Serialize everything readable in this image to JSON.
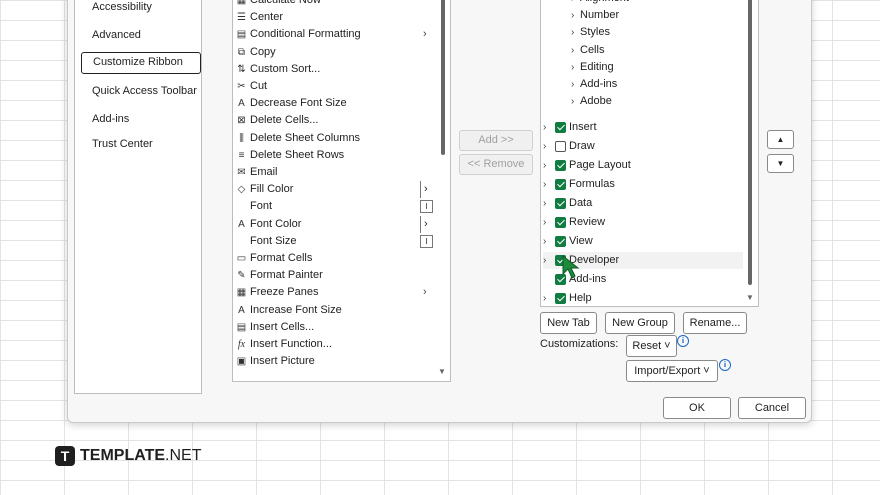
{
  "nav": {
    "items": [
      "Accessibility",
      "Advanced",
      "Customize Ribbon",
      "Quick Access Toolbar",
      "Add-ins",
      "Trust Center"
    ],
    "selected": "Customize Ribbon"
  },
  "commands": [
    {
      "label": "Calculate Now",
      "icon": "calculator-icon",
      "glyph": "▦"
    },
    {
      "label": "Center",
      "icon": "align-center-icon",
      "glyph": "☰"
    },
    {
      "label": "Conditional Formatting",
      "icon": "conditional-formatting-icon",
      "glyph": "▤",
      "arrow": "›"
    },
    {
      "label": "Copy",
      "icon": "copy-icon",
      "glyph": "⧉"
    },
    {
      "label": "Custom Sort...",
      "icon": "sort-icon",
      "glyph": "⇅"
    },
    {
      "label": "Cut",
      "icon": "scissors-icon",
      "glyph": "✂"
    },
    {
      "label": "Decrease Font Size",
      "icon": "decrease-font-icon",
      "glyph": "A"
    },
    {
      "label": "Delete Cells...",
      "icon": "delete-cells-icon",
      "glyph": "⊠"
    },
    {
      "label": "Delete Sheet Columns",
      "icon": "delete-columns-icon",
      "glyph": "⫼"
    },
    {
      "label": "Delete Sheet Rows",
      "icon": "delete-rows-icon",
      "glyph": "≡"
    },
    {
      "label": "Email",
      "icon": "email-icon",
      "glyph": "✉"
    },
    {
      "label": "Fill Color",
      "icon": "fill-color-icon",
      "glyph": "◇",
      "bar_arrow": "›"
    },
    {
      "label": "Font",
      "icon": "",
      "glyph": "",
      "mini": "I"
    },
    {
      "label": "Font Color",
      "icon": "font-color-icon",
      "glyph": "A",
      "bar_arrow": "›"
    },
    {
      "label": "Font Size",
      "icon": "",
      "glyph": "",
      "mini": "I"
    },
    {
      "label": "Format Cells",
      "icon": "format-cells-icon",
      "glyph": "▭"
    },
    {
      "label": "Format Painter",
      "icon": "paintbrush-icon",
      "glyph": "✎"
    },
    {
      "label": "Freeze Panes",
      "icon": "freeze-panes-icon",
      "glyph": "▦",
      "arrow": "›"
    },
    {
      "label": "Increase Font Size",
      "icon": "increase-font-icon",
      "glyph": "A"
    },
    {
      "label": "Insert Cells...",
      "icon": "insert-cells-icon",
      "glyph": "▤"
    },
    {
      "label": "Insert Function...",
      "icon": "function-icon",
      "glyph": "fx"
    },
    {
      "label": "Insert Picture",
      "icon": "picture-icon",
      "glyph": "▣"
    }
  ],
  "middle": {
    "add": "Add >>",
    "remove": "<< Remove"
  },
  "tree": {
    "subgroups": [
      "Alignment",
      "Number",
      "Styles",
      "Cells",
      "Editing",
      "Add-ins",
      "Adobe"
    ],
    "tabs": [
      {
        "label": "Insert",
        "checked": true
      },
      {
        "label": "Draw",
        "checked": false
      },
      {
        "label": "Page Layout",
        "checked": true
      },
      {
        "label": "Formulas",
        "checked": true
      },
      {
        "label": "Data",
        "checked": true
      },
      {
        "label": "Review",
        "checked": true
      },
      {
        "label": "View",
        "checked": true
      },
      {
        "label": "Developer",
        "checked": true
      },
      {
        "label": "Add-ins",
        "checked": true
      },
      {
        "label": "Help",
        "checked": true
      }
    ]
  },
  "buttons": {
    "new_tab": "New Tab",
    "new_group": "New Group",
    "rename": "Rename...",
    "customizations_label": "Customizations:",
    "reset": "Reset ˅",
    "import_export": "Import/Export ˅",
    "ok": "OK",
    "cancel": "Cancel"
  },
  "brand": {
    "mark": "T",
    "bold": "TEMPLATE",
    "rest": ".NET"
  },
  "colors": {
    "check": "#107c41",
    "cursor": "#1e8a3c",
    "info": "#1a66c9"
  }
}
